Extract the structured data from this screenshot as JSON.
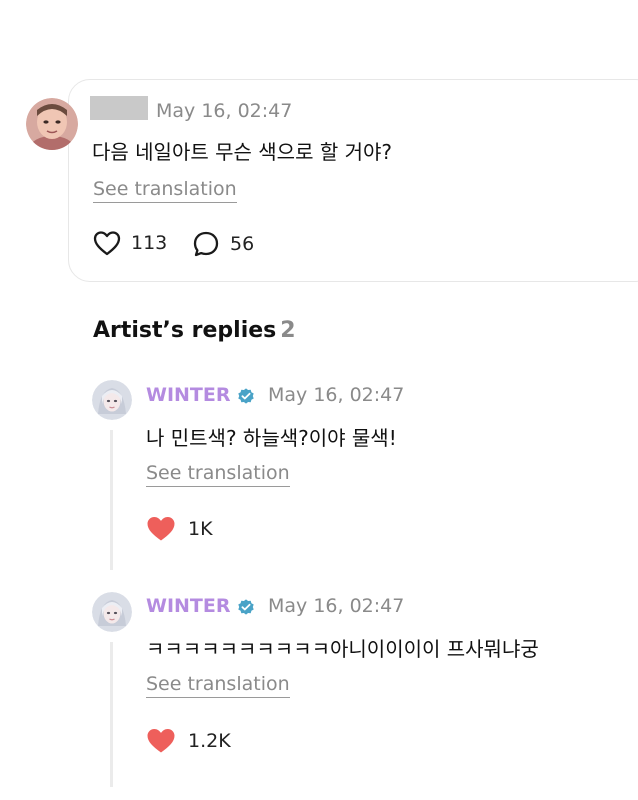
{
  "post": {
    "date": "May 16, 02:47",
    "text": "다음 네일아트 무슨 색으로 할 거야?",
    "translate_label": "See translation",
    "likes": "113",
    "comments": "56"
  },
  "replies_section": {
    "title": "Artist’s replies",
    "count": "2"
  },
  "replies": [
    {
      "author": "WINTER",
      "date": "May 16, 02:47",
      "text": "나 민트색? 하늘색?이야 물색!",
      "translate_label": "See translation",
      "likes": "1K"
    },
    {
      "author": "WINTER",
      "date": "May 16, 02:47",
      "text": "ㅋㅋㅋㅋㅋㅋㅋㅋㅋㅋ아니이이이이 프사뭐냐궁",
      "translate_label": "See translation",
      "likes": "1.2K"
    }
  ],
  "colors": {
    "artist_name": "#b48be0",
    "verified_badge": "#4aa3c7",
    "heart_filled": "#ee5f5b",
    "muted_text": "#8a8a8a"
  },
  "icons": [
    "heart-outline-icon",
    "comment-bubble-icon",
    "verified-badge-icon",
    "heart-filled-icon"
  ]
}
